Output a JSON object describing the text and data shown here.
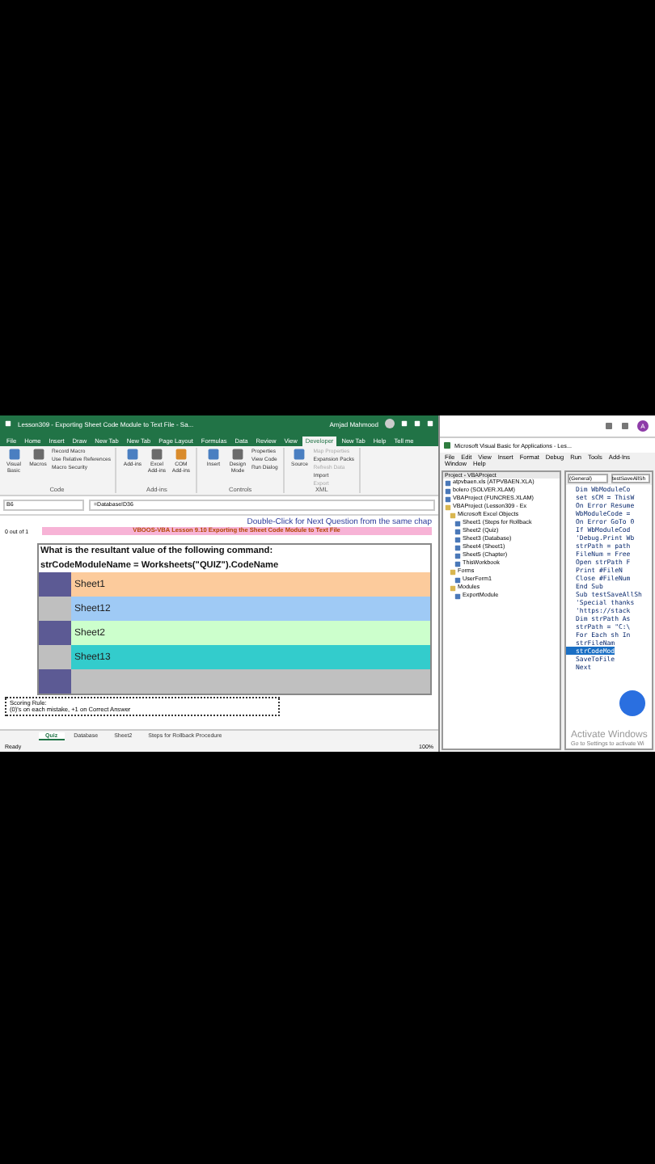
{
  "excel": {
    "title": "Lesson309 - Exporting Sheet Code Module to Text File - Sa...",
    "user": "Amjad Mahmood",
    "tabs": [
      {
        "label": "File",
        "selected": false
      },
      {
        "label": "Home",
        "selected": false
      },
      {
        "label": "Insert",
        "selected": false
      },
      {
        "label": "Draw",
        "selected": false
      },
      {
        "label": "New Tab",
        "selected": false
      },
      {
        "label": "New Tab",
        "selected": false
      },
      {
        "label": "Page Layout",
        "selected": false
      },
      {
        "label": "Formulas",
        "selected": false
      },
      {
        "label": "Data",
        "selected": false
      },
      {
        "label": "Review",
        "selected": false
      },
      {
        "label": "View",
        "selected": false
      },
      {
        "label": "Developer",
        "selected": true
      },
      {
        "label": "New Tab",
        "selected": false
      },
      {
        "label": "Help",
        "selected": false
      },
      {
        "label": "Tell me",
        "selected": false
      }
    ],
    "ribbon_groups": [
      {
        "name": "Code",
        "big": [
          "Visual Basic",
          "Macros"
        ],
        "small": [
          {
            "label": "Record Macro",
            "disabled": false
          },
          {
            "label": "Use Relative References",
            "disabled": false
          },
          {
            "label": "Macro Security",
            "disabled": false
          }
        ]
      },
      {
        "name": "Add-ins",
        "big": [
          "Add-ins",
          "Excel Add-ins",
          "COM Add-ins"
        ]
      },
      {
        "name": "Controls",
        "big": [
          "Insert",
          "Design Mode"
        ],
        "small": [
          {
            "label": "Properties",
            "disabled": false
          },
          {
            "label": "View Code",
            "disabled": false
          },
          {
            "label": "Run Dialog",
            "disabled": false
          }
        ]
      },
      {
        "name": "XML",
        "big": [
          "Source"
        ],
        "small": [
          {
            "label": "Map Properties",
            "disabled": true
          },
          {
            "label": "Expansion Packs",
            "disabled": false
          },
          {
            "label": "Refresh Data",
            "disabled": true
          },
          {
            "label": "Import",
            "disabled": false
          },
          {
            "label": "Export",
            "disabled": true
          }
        ]
      }
    ],
    "name_box": "B6",
    "formula": "=Database!D36",
    "sheet": {
      "hint": "Double-Click for Next Question from the same chap",
      "score": "0 out of 1",
      "banner": "VBOOS-VBA Lesson 9.10 Exporting the Sheet Code Module to Text File",
      "question": "What is the resultant value of the following command:",
      "command": "strCodeModuleName = Worksheets(\"QUIZ\").CodeName",
      "options": [
        {
          "text": "Sheet1",
          "color": "#fccb9c"
        },
        {
          "text": "Sheet12",
          "color": "#9fcaf5"
        },
        {
          "text": "Sheet2",
          "color": "#ccffcc"
        },
        {
          "text": "Sheet13",
          "color": "#33cccc"
        },
        {
          "color": "#c0c0c0"
        }
      ],
      "scoring_title": "Scoring Rule:",
      "scoring_text": "(0)'s on each mistake, +1 on Correct Answer"
    },
    "sheet_tabs": [
      {
        "label": "Quiz",
        "selected": true
      },
      {
        "label": "Database",
        "selected": false
      },
      {
        "label": "Sheet2",
        "selected": false
      },
      {
        "label": "Steps for Rollback Procedure",
        "selected": false
      }
    ],
    "status": "Ready",
    "zoom": "100%"
  },
  "vbe": {
    "avatar": "A",
    "title": "Microsoft Visual Basic for Applications - Les...",
    "menu": [
      "File",
      "Edit",
      "View",
      "Insert",
      "Format",
      "Debug",
      "Run",
      "Tools",
      "Add-Ins",
      "Window",
      "Help"
    ],
    "project_title": "Project - VBAProject",
    "tree": [
      {
        "label": "atpvbaen.xls (ATPVBAEN.XLA)"
      },
      {
        "label": "bolero (SOLVER.XLAM)"
      },
      {
        "label": "VBAProject (FUNCRES.XLAM)"
      },
      {
        "label": "VBAProject (Lesson309 - Ex",
        "children": [
          {
            "label": "Microsoft Excel Objects",
            "children": [
              {
                "label": "Sheet1 (Steps for Rollback"
              },
              {
                "label": "Sheet2 (Quiz)"
              },
              {
                "label": "Sheet3 (Database)"
              },
              {
                "label": "Sheet4 (Sheet1)"
              },
              {
                "label": "Sheet5 (Chapter)"
              },
              {
                "label": "ThisWorkbook"
              }
            ]
          },
          {
            "label": "Forms",
            "children": [
              {
                "label": "UserForm1"
              }
            ]
          },
          {
            "label": "Modules",
            "children": [
              {
                "label": "ExportModule"
              }
            ]
          }
        ]
      }
    ],
    "object_box": "(General)",
    "proc_box": "testSaveAllSh",
    "code": [
      {
        "text": "Dim WbModuleCo",
        "selected": false
      },
      {
        "text": "set sCM = ThisW",
        "selected": false
      },
      {
        "text": "On Error Resume",
        "selected": false
      },
      {
        "text": "WbModuleCode = ",
        "selected": false
      },
      {
        "text": "On Error GoTo 0",
        "selected": false
      },
      {
        "text": "If WbModuleCod",
        "selected": false
      },
      {
        "text": "'Debug.Print Wb",
        "selected": false
      },
      {
        "text": "strPath = path",
        "selected": false
      },
      {
        "text": "FileNum = Free",
        "selected": false
      },
      {
        "text": "Open strPath F",
        "selected": false
      },
      {
        "text": "Print #FileN",
        "selected": false
      },
      {
        "text": "Close #FileNum",
        "selected": false
      },
      {
        "text": "End Sub",
        "selected": false
      },
      {
        "text": "Sub testSaveAllSh",
        "selected": false
      },
      {
        "text": "'Special thanks",
        "selected": false
      },
      {
        "text": "'https://stack",
        "selected": false
      },
      {
        "text": "Dim strPath As",
        "selected": false
      },
      {
        "text": "strPath = \"C:\\",
        "selected": false
      },
      {
        "text": "For Each sh In",
        "selected": false
      },
      {
        "text": "strFileNam",
        "selected": false
      },
      {
        "text": "strCodeMod",
        "selected": true
      },
      {
        "text": "SaveToFile",
        "selected": false
      },
      {
        "text": "Next",
        "selected": false
      }
    ],
    "watermark_title": "Activate Windows",
    "watermark_text": "Go to Settings to activate Wi"
  }
}
